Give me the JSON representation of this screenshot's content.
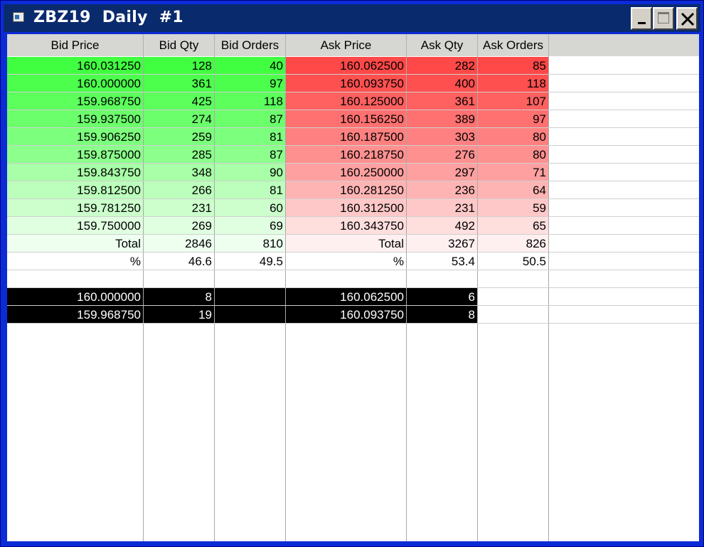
{
  "window": {
    "title": "ZBZ19  Daily  #1"
  },
  "columns": [
    "Bid Price",
    "Bid Qty",
    "Bid Orders",
    "Ask Price",
    "Ask Qty",
    "Ask Orders"
  ],
  "book": [
    [
      "160.031250",
      "128",
      "40",
      "160.062500",
      "282",
      "85"
    ],
    [
      "160.000000",
      "361",
      "97",
      "160.093750",
      "400",
      "118"
    ],
    [
      "159.968750",
      "425",
      "118",
      "160.125000",
      "361",
      "107"
    ],
    [
      "159.937500",
      "274",
      "87",
      "160.156250",
      "389",
      "97"
    ],
    [
      "159.906250",
      "259",
      "81",
      "160.187500",
      "303",
      "80"
    ],
    [
      "159.875000",
      "285",
      "87",
      "160.218750",
      "276",
      "80"
    ],
    [
      "159.843750",
      "348",
      "90",
      "160.250000",
      "297",
      "71"
    ],
    [
      "159.812500",
      "266",
      "81",
      "160.281250",
      "236",
      "64"
    ],
    [
      "159.781250",
      "231",
      "60",
      "160.312500",
      "231",
      "59"
    ],
    [
      "159.750000",
      "269",
      "69",
      "160.343750",
      "492",
      "65"
    ]
  ],
  "totals": [
    "Total",
    "2846",
    "810",
    "Total",
    "3267",
    "826"
  ],
  "percent": [
    "%",
    "46.6",
    "49.5",
    "%",
    "53.4",
    "50.5"
  ],
  "trades": [
    [
      "160.000000",
      "8",
      "",
      "160.062500",
      "6"
    ],
    [
      "159.968750",
      "19",
      "",
      "160.093750",
      "8"
    ]
  ],
  "colors": {
    "bid": [
      "#40ff40",
      "#4cff4c",
      "#5cff5c",
      "#6cff6c",
      "#7cff7c",
      "#8cff8c",
      "#a8ffa8",
      "#bcffbc",
      "#ccffcc",
      "#e0ffe0"
    ],
    "ask": [
      "#ff4848",
      "#ff5050",
      "#ff6060",
      "#ff7070",
      "#ff8080",
      "#ff9090",
      "#ffa0a0",
      "#ffb4b4",
      "#ffc8c8",
      "#ffdede"
    ],
    "bid_total": "#eefff0",
    "ask_total": "#fff0f0"
  }
}
